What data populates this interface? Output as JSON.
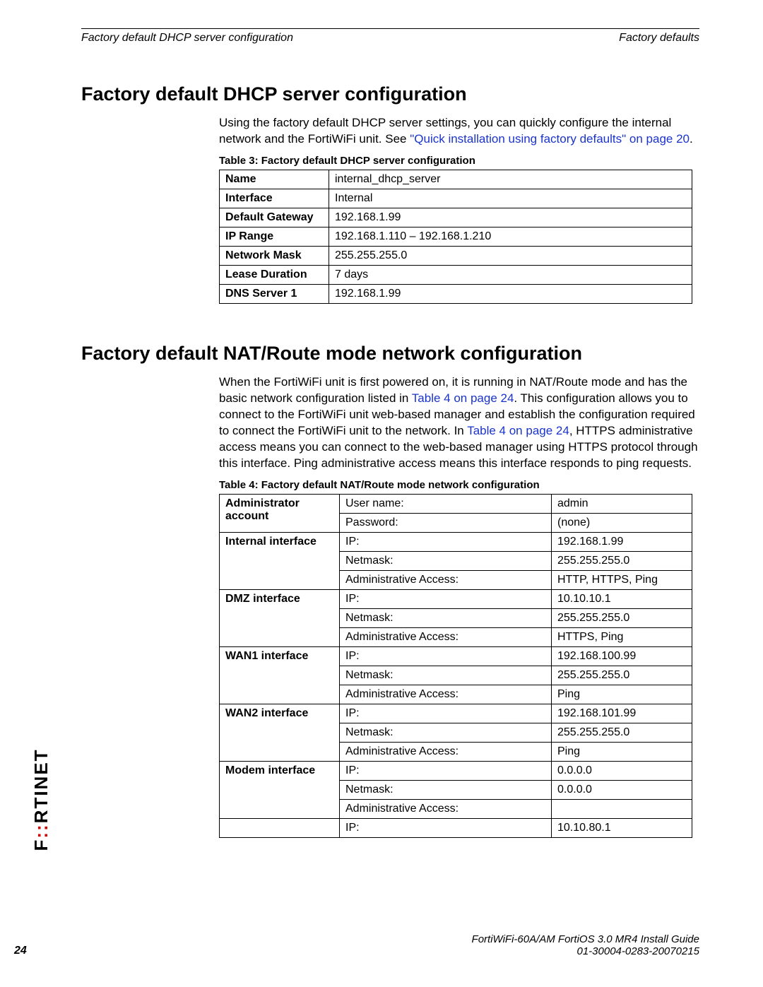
{
  "running": {
    "left": "Factory default DHCP server configuration",
    "right": "Factory defaults"
  },
  "section1": {
    "title": "Factory default DHCP server configuration",
    "para_a": "Using the factory default DHCP server settings, you can quickly configure the internal network and the FortiWiFi unit. See ",
    "link": "\"Quick installation using factory defaults\" on page 20",
    "para_b": ".",
    "table_caption": "Table 3: Factory default DHCP server configuration",
    "rows": [
      {
        "label": "Name",
        "value": "internal_dhcp_server"
      },
      {
        "label": "Interface",
        "value": "Internal"
      },
      {
        "label": "Default Gateway",
        "value": "192.168.1.99"
      },
      {
        "label": "IP Range",
        "value": "192.168.1.110 – 192.168.1.210"
      },
      {
        "label": "Network Mask",
        "value": "255.255.255.0"
      },
      {
        "label": "Lease Duration",
        "value": "7 days"
      },
      {
        "label": "DNS Server 1",
        "value": "192.168.1.99"
      }
    ]
  },
  "section2": {
    "title": "Factory default NAT/Route mode network configuration",
    "para_a": "When the FortiWiFi unit is first powered on, it is running in NAT/Route mode and has the basic network configuration listed in ",
    "link1": "Table 4 on page 24",
    "para_b": ". This configuration allows you to connect to the FortiWiFi unit web-based manager and establish the configuration required to connect the FortiWiFi unit to the network. In ",
    "link2": "Table 4 on page 24",
    "para_c": ", HTTPS administrative access means you can connect to the web-based manager using HTTPS protocol through this interface. Ping administrative access means this interface responds to ping requests.",
    "table_caption": "Table 4: Factory default NAT/Route mode network configuration",
    "groups": [
      {
        "label": "Administrator account",
        "rows": [
          {
            "k": "User name:",
            "v": "admin"
          },
          {
            "k": "Password:",
            "v": "(none)"
          }
        ]
      },
      {
        "label": "Internal interface",
        "rows": [
          {
            "k": "IP:",
            "v": "192.168.1.99"
          },
          {
            "k": "Netmask:",
            "v": "255.255.255.0"
          },
          {
            "k": "Administrative Access:",
            "v": "HTTP, HTTPS, Ping"
          }
        ]
      },
      {
        "label": "DMZ interface",
        "rows": [
          {
            "k": "IP:",
            "v": "10.10.10.1"
          },
          {
            "k": "Netmask:",
            "v": "255.255.255.0"
          },
          {
            "k": "Administrative Access:",
            "v": "HTTPS, Ping"
          }
        ]
      },
      {
        "label": "WAN1 interface",
        "rows": [
          {
            "k": "IP:",
            "v": "192.168.100.99"
          },
          {
            "k": "Netmask:",
            "v": "255.255.255.0"
          },
          {
            "k": "Administrative Access:",
            "v": "Ping"
          }
        ]
      },
      {
        "label": "WAN2 interface",
        "rows": [
          {
            "k": "IP:",
            "v": "192.168.101.99"
          },
          {
            "k": "Netmask:",
            "v": "255.255.255.0"
          },
          {
            "k": "Administrative Access:",
            "v": "Ping"
          }
        ]
      },
      {
        "label": "Modem interface",
        "rows": [
          {
            "k": "IP:",
            "v": "0.0.0.0"
          },
          {
            "k": "Netmask:",
            "v": "0.0.0.0"
          },
          {
            "k": "Administrative Access:",
            "v": ""
          }
        ]
      },
      {
        "label": "",
        "rows": [
          {
            "k": "IP:",
            "v": "10.10.80.1"
          }
        ]
      }
    ]
  },
  "footer": {
    "line1": "FortiWiFi-60A/AM FortiOS 3.0 MR4 Install Guide",
    "line2": "01-30004-0283-20070215",
    "page": "24"
  }
}
